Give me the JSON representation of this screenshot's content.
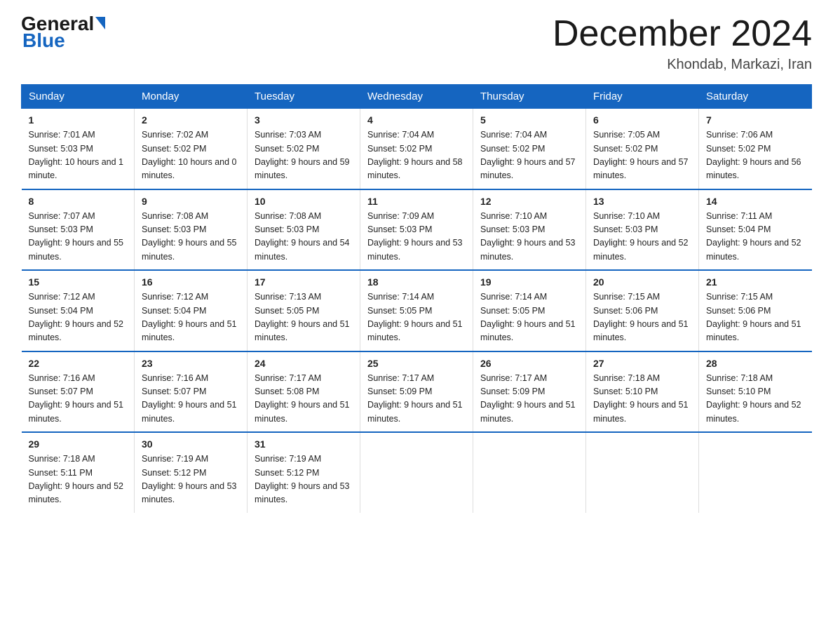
{
  "header": {
    "logo_general": "General",
    "logo_blue": "Blue",
    "month_title": "December 2024",
    "location": "Khondab, Markazi, Iran"
  },
  "weekdays": [
    "Sunday",
    "Monday",
    "Tuesday",
    "Wednesday",
    "Thursday",
    "Friday",
    "Saturday"
  ],
  "weeks": [
    [
      {
        "day": "1",
        "sunrise": "7:01 AM",
        "sunset": "5:03 PM",
        "daylight": "10 hours and 1 minute."
      },
      {
        "day": "2",
        "sunrise": "7:02 AM",
        "sunset": "5:02 PM",
        "daylight": "10 hours and 0 minutes."
      },
      {
        "day": "3",
        "sunrise": "7:03 AM",
        "sunset": "5:02 PM",
        "daylight": "9 hours and 59 minutes."
      },
      {
        "day": "4",
        "sunrise": "7:04 AM",
        "sunset": "5:02 PM",
        "daylight": "9 hours and 58 minutes."
      },
      {
        "day": "5",
        "sunrise": "7:04 AM",
        "sunset": "5:02 PM",
        "daylight": "9 hours and 57 minutes."
      },
      {
        "day": "6",
        "sunrise": "7:05 AM",
        "sunset": "5:02 PM",
        "daylight": "9 hours and 57 minutes."
      },
      {
        "day": "7",
        "sunrise": "7:06 AM",
        "sunset": "5:02 PM",
        "daylight": "9 hours and 56 minutes."
      }
    ],
    [
      {
        "day": "8",
        "sunrise": "7:07 AM",
        "sunset": "5:03 PM",
        "daylight": "9 hours and 55 minutes."
      },
      {
        "day": "9",
        "sunrise": "7:08 AM",
        "sunset": "5:03 PM",
        "daylight": "9 hours and 55 minutes."
      },
      {
        "day": "10",
        "sunrise": "7:08 AM",
        "sunset": "5:03 PM",
        "daylight": "9 hours and 54 minutes."
      },
      {
        "day": "11",
        "sunrise": "7:09 AM",
        "sunset": "5:03 PM",
        "daylight": "9 hours and 53 minutes."
      },
      {
        "day": "12",
        "sunrise": "7:10 AM",
        "sunset": "5:03 PM",
        "daylight": "9 hours and 53 minutes."
      },
      {
        "day": "13",
        "sunrise": "7:10 AM",
        "sunset": "5:03 PM",
        "daylight": "9 hours and 52 minutes."
      },
      {
        "day": "14",
        "sunrise": "7:11 AM",
        "sunset": "5:04 PM",
        "daylight": "9 hours and 52 minutes."
      }
    ],
    [
      {
        "day": "15",
        "sunrise": "7:12 AM",
        "sunset": "5:04 PM",
        "daylight": "9 hours and 52 minutes."
      },
      {
        "day": "16",
        "sunrise": "7:12 AM",
        "sunset": "5:04 PM",
        "daylight": "9 hours and 51 minutes."
      },
      {
        "day": "17",
        "sunrise": "7:13 AM",
        "sunset": "5:05 PM",
        "daylight": "9 hours and 51 minutes."
      },
      {
        "day": "18",
        "sunrise": "7:14 AM",
        "sunset": "5:05 PM",
        "daylight": "9 hours and 51 minutes."
      },
      {
        "day": "19",
        "sunrise": "7:14 AM",
        "sunset": "5:05 PM",
        "daylight": "9 hours and 51 minutes."
      },
      {
        "day": "20",
        "sunrise": "7:15 AM",
        "sunset": "5:06 PM",
        "daylight": "9 hours and 51 minutes."
      },
      {
        "day": "21",
        "sunrise": "7:15 AM",
        "sunset": "5:06 PM",
        "daylight": "9 hours and 51 minutes."
      }
    ],
    [
      {
        "day": "22",
        "sunrise": "7:16 AM",
        "sunset": "5:07 PM",
        "daylight": "9 hours and 51 minutes."
      },
      {
        "day": "23",
        "sunrise": "7:16 AM",
        "sunset": "5:07 PM",
        "daylight": "9 hours and 51 minutes."
      },
      {
        "day": "24",
        "sunrise": "7:17 AM",
        "sunset": "5:08 PM",
        "daylight": "9 hours and 51 minutes."
      },
      {
        "day": "25",
        "sunrise": "7:17 AM",
        "sunset": "5:09 PM",
        "daylight": "9 hours and 51 minutes."
      },
      {
        "day": "26",
        "sunrise": "7:17 AM",
        "sunset": "5:09 PM",
        "daylight": "9 hours and 51 minutes."
      },
      {
        "day": "27",
        "sunrise": "7:18 AM",
        "sunset": "5:10 PM",
        "daylight": "9 hours and 51 minutes."
      },
      {
        "day": "28",
        "sunrise": "7:18 AM",
        "sunset": "5:10 PM",
        "daylight": "9 hours and 52 minutes."
      }
    ],
    [
      {
        "day": "29",
        "sunrise": "7:18 AM",
        "sunset": "5:11 PM",
        "daylight": "9 hours and 52 minutes."
      },
      {
        "day": "30",
        "sunrise": "7:19 AM",
        "sunset": "5:12 PM",
        "daylight": "9 hours and 53 minutes."
      },
      {
        "day": "31",
        "sunrise": "7:19 AM",
        "sunset": "5:12 PM",
        "daylight": "9 hours and 53 minutes."
      },
      null,
      null,
      null,
      null
    ]
  ]
}
